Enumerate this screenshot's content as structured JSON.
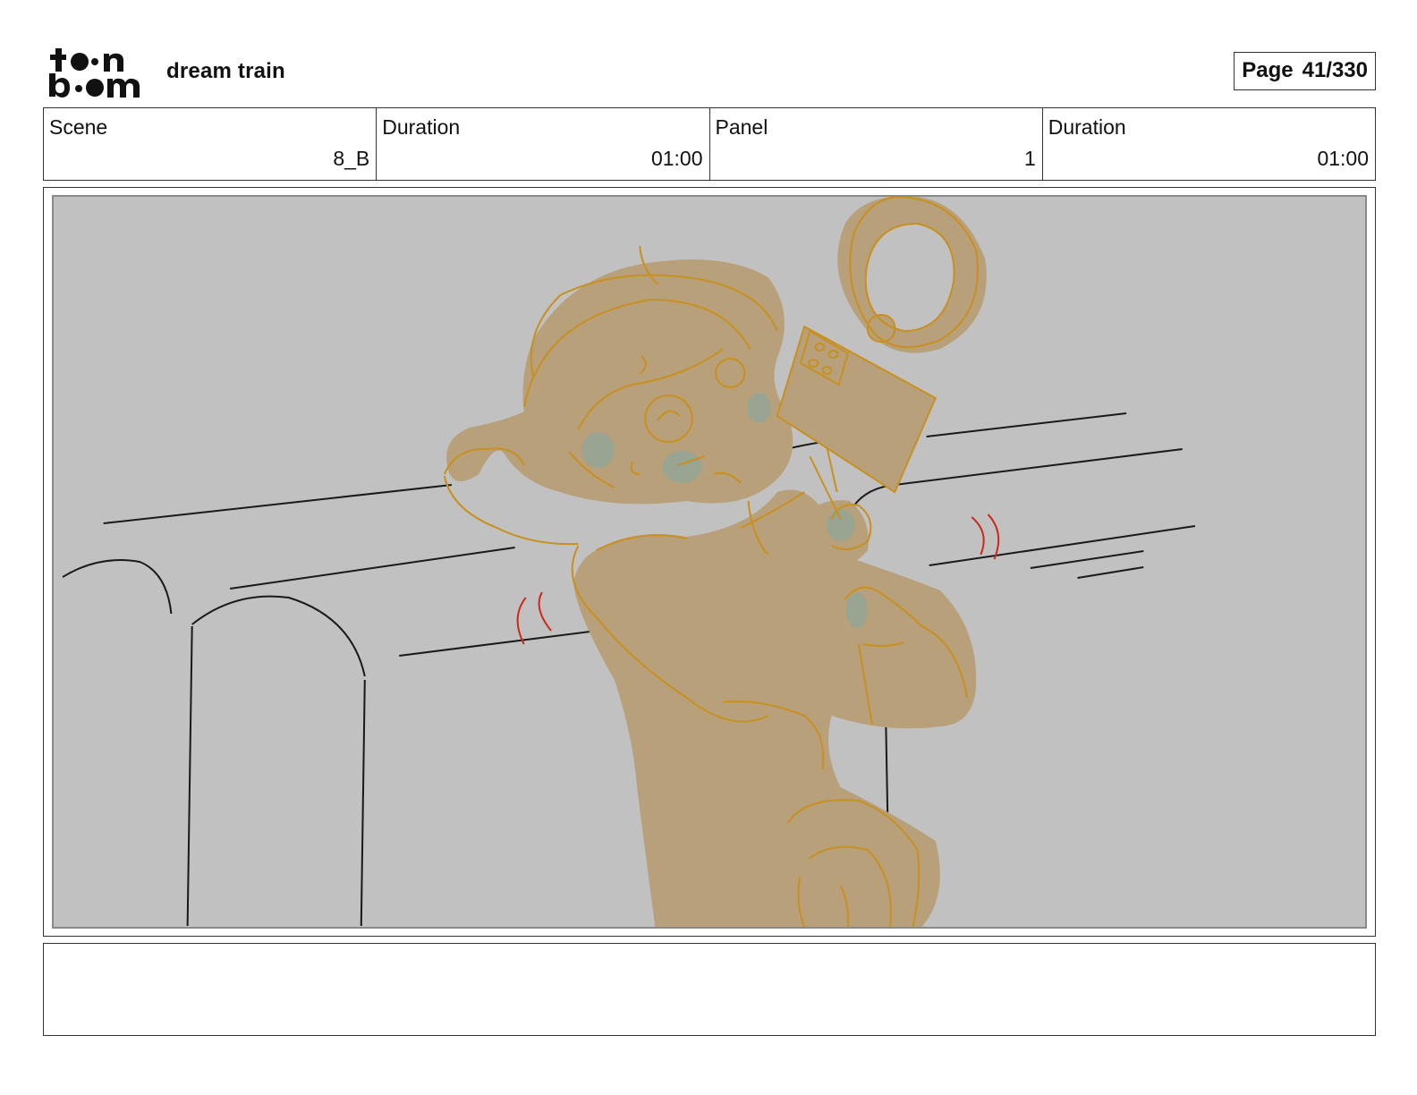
{
  "header": {
    "logo_icon": "toonboom-logo",
    "project_title": "dream train",
    "page_label": "Page",
    "page_number": "41/330"
  },
  "info": {
    "scene_label": "Scene",
    "scene_value": "8_B",
    "scene_duration_label": "Duration",
    "scene_duration_value": "01:00",
    "panel_label": "Panel",
    "panel_value": "1",
    "panel_duration_label": "Duration",
    "panel_duration_value": "01:00"
  },
  "panel_art": {
    "description_icon": "storyboard-sketch-girl-on-train",
    "colors": {
      "background": "#c1c1c1",
      "figure_fill": "#b8a07a",
      "figure_line": "#c89020",
      "blush": "#8fa69a",
      "motion_marks": "#cc2a1a",
      "set_lines": "#1a1a1a"
    }
  },
  "notes": {
    "text": ""
  }
}
